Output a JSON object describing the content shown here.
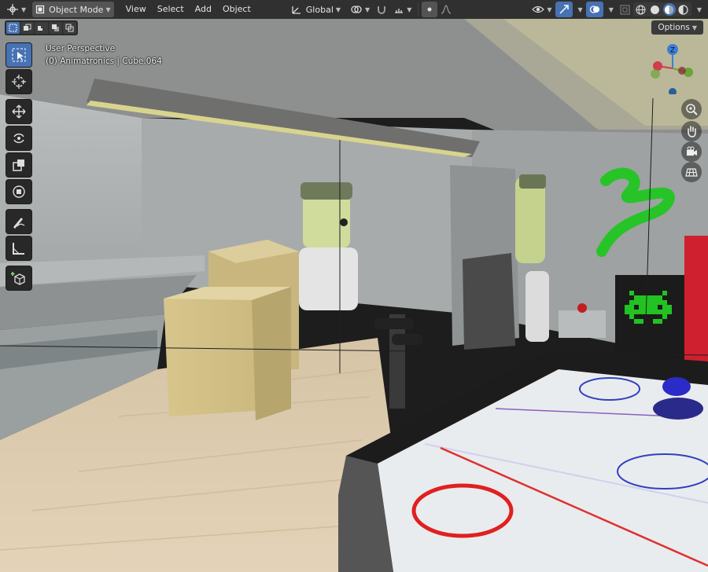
{
  "header": {
    "mode_label": "Object Mode",
    "menu": [
      "View",
      "Select",
      "Add",
      "Object"
    ],
    "orientation_label": "Global"
  },
  "overlay": {
    "view_name": "User Perspective",
    "object_info": "(0) Animatronics | Cube.064"
  },
  "options_label": "Options",
  "gizmo": {
    "axis_z": "Z"
  },
  "tools": [
    "select-box-icon",
    "cursor-icon",
    "move-icon",
    "rotate-icon",
    "scale-icon",
    "transform-icon",
    "annotate-icon",
    "measure-icon",
    "add-cube-icon"
  ],
  "colors": {
    "accent": "#4772b3",
    "header_bg": "#303030",
    "axis_x": "#d33b4e",
    "axis_y": "#6ca537",
    "axis_z": "#3c7ed7"
  }
}
